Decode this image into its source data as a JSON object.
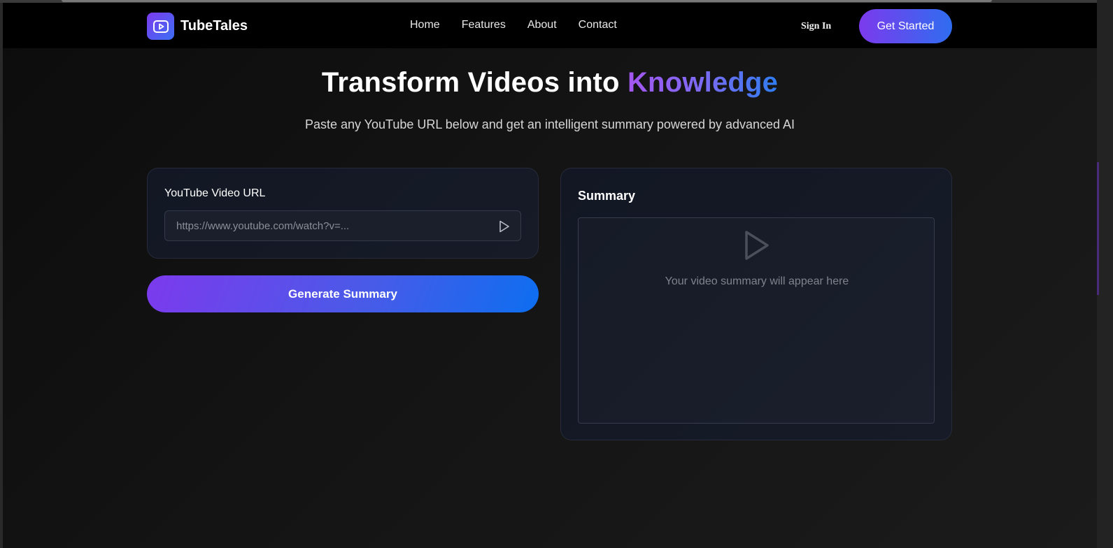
{
  "brand": {
    "name": "TubeTales",
    "gradient": [
      "#7c3aed",
      "#3b6ff5"
    ]
  },
  "nav": {
    "links": [
      "Home",
      "Features",
      "About",
      "Contact"
    ],
    "sign_in": "Sign In",
    "get_started": "Get Started"
  },
  "hero": {
    "title_prefix": "Transform Videos into ",
    "title_accent": "Knowledge",
    "subtitle": "Paste any YouTube URL below and get an intelligent summary powered by advanced AI"
  },
  "input_card": {
    "label": "YouTube Video URL",
    "placeholder": "https://www.youtube.com/watch?v=...",
    "value": "",
    "submit_icon": "play-arrow-icon"
  },
  "generate_button": {
    "label": "Generate Summary"
  },
  "summary": {
    "title": "Summary",
    "placeholder": "Your video summary will appear here",
    "icon": "play-outline-icon"
  },
  "colors": {
    "accent_purple": "#7c3aed",
    "accent_blue": "#0d6ef0",
    "background": "#0c0c0c"
  }
}
